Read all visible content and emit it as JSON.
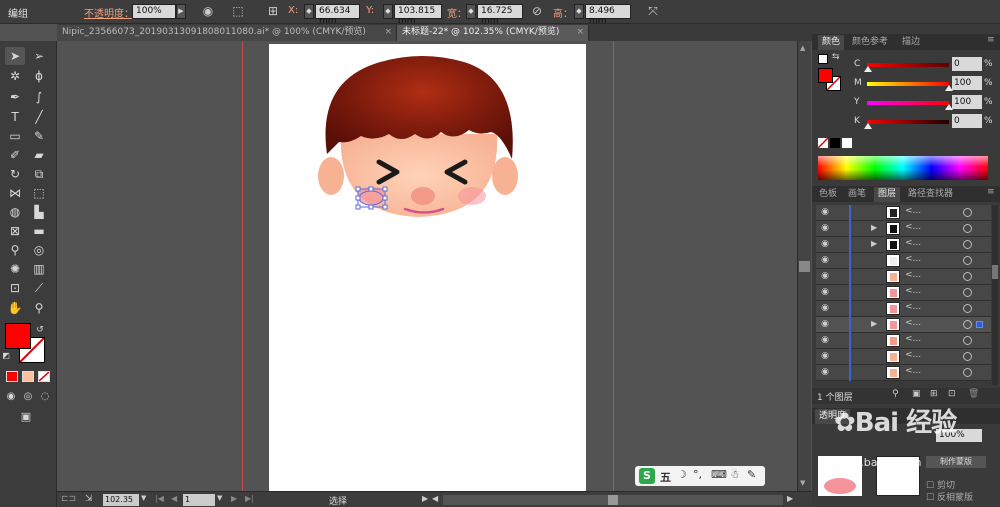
{
  "control_bar": {
    "group_label": "编组",
    "opacity_label": "不透明度：",
    "opacity_value": "100%",
    "x_label": "X:",
    "x_value": "66.634 mm",
    "y_label": "Y:",
    "y_value": "103.815 mm",
    "w_label": "宽：",
    "w_value": "16.725 mm",
    "h_label": "高：",
    "h_value": "8.496 mm"
  },
  "documents": [
    {
      "title": "Nipic_23566073_20190313091808011080.ai* @ 100% (CMYK/预览)",
      "active": false
    },
    {
      "title": "未标题-22* @ 102.35% (CMYK/预览)",
      "active": true
    }
  ],
  "status_bar": {
    "zoom": "102.35",
    "artboard_number": "1",
    "tool_name": "选择"
  },
  "color_panel": {
    "tabs": [
      "颜色",
      "颜色参考",
      "描边"
    ],
    "channels": [
      {
        "key": "C",
        "value": "0",
        "unit": "%",
        "level": 0
      },
      {
        "key": "M",
        "value": "100",
        "unit": "%",
        "level": 100
      },
      {
        "key": "Y",
        "value": "100",
        "unit": "%",
        "level": 100
      },
      {
        "key": "K",
        "value": "0",
        "unit": "%",
        "level": 0
      }
    ],
    "fill_color": "#ff0000"
  },
  "layers_panel": {
    "tabs": [
      "色板",
      "画笔",
      "图层",
      "路径查找器"
    ],
    "rows": [
      {
        "name": "<...",
        "expandable": false,
        "selected": false
      },
      {
        "name": "<...",
        "expandable": true,
        "selected": false
      },
      {
        "name": "<...",
        "expandable": true,
        "selected": false
      },
      {
        "name": "<...",
        "expandable": false,
        "selected": false
      },
      {
        "name": "<...",
        "expandable": false,
        "selected": false
      },
      {
        "name": "<...",
        "expandable": false,
        "selected": false
      },
      {
        "name": "<...",
        "expandable": false,
        "selected": false
      },
      {
        "name": "<...",
        "expandable": true,
        "selected": true
      },
      {
        "name": "<...",
        "expandable": false,
        "selected": false
      },
      {
        "name": "<...",
        "expandable": false,
        "selected": false
      },
      {
        "name": "<...",
        "expandable": false,
        "selected": false
      }
    ],
    "count_label": "1 个图层"
  },
  "bottom_panel": {
    "tab_label": "透明度",
    "opacity_value": "100%",
    "clip_label": "剪切",
    "invert_label": "反相蒙版",
    "make_mask_label": "制作蒙版"
  },
  "ime_bar": {
    "label": "五"
  },
  "watermark": {
    "text": "Bai 经验",
    "url": "jingyan.baidu.com"
  },
  "colors": {
    "fill": "#ff0000",
    "stroke": "#ffffff",
    "guide": "#c64a4a",
    "hair_dark": "#5a0f08",
    "hair_light": "#b02e13",
    "skin": "#fbc0a0"
  }
}
